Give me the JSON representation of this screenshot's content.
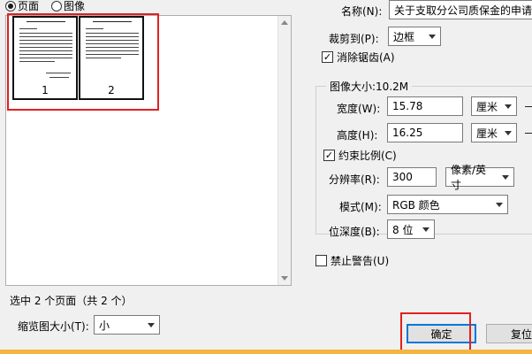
{
  "preview_mode": {
    "page_label": "页面",
    "image_label": "图像",
    "selected": "page"
  },
  "thumbnails": [
    {
      "number": "1"
    },
    {
      "number": "2"
    }
  ],
  "selection_status": "选中 2 个页面（共 2 个）",
  "thumb_size": {
    "label": "缩览图大小(T):",
    "value": "小"
  },
  "name": {
    "label": "名称(N):",
    "value": "关于支取分公司质保金的申请"
  },
  "crop": {
    "label": "裁剪到(P):",
    "value": "边框"
  },
  "antialias": {
    "label": "消除锯齿(A)",
    "checked": true
  },
  "image_size": {
    "title": "图像大小:10.2M",
    "width": {
      "label": "宽度(W):",
      "value": "15.78",
      "unit": "厘米"
    },
    "height": {
      "label": "高度(H):",
      "value": "16.25",
      "unit": "厘米"
    },
    "constrain": {
      "label": "约束比例(C)",
      "checked": true
    },
    "resolution": {
      "label": "分辨率(R):",
      "value": "300",
      "unit": "像素/英寸"
    },
    "mode": {
      "label": "模式(M):",
      "value": "RGB 颜色"
    },
    "bit_depth": {
      "label": "位深度(B):",
      "value": "8 位"
    }
  },
  "suppress_warnings": {
    "label": "禁止警告(U)",
    "checked": false
  },
  "buttons": {
    "ok": "确定",
    "reset": "复位"
  },
  "colors": {
    "highlight_red": "#e02020",
    "default_button_border": "#0078d7"
  }
}
